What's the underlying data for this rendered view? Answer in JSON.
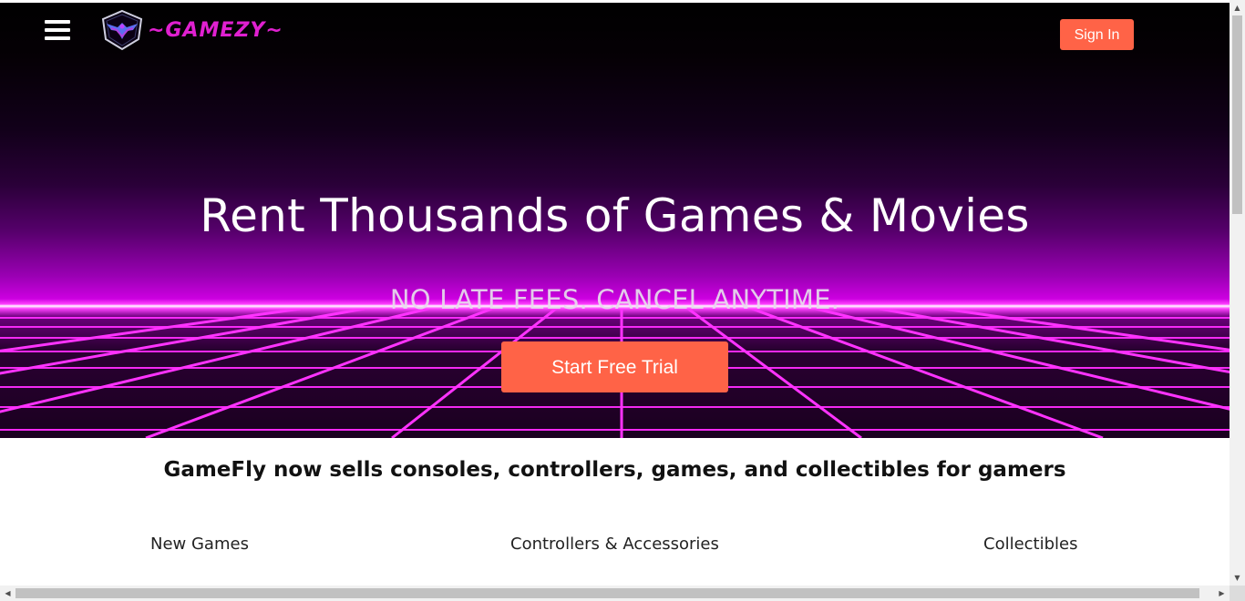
{
  "header": {
    "menu_icon": "hamburger-menu-icon",
    "logo_icon": "winged-shield-logo-icon",
    "logo_text": "~GAMEZY~",
    "signin_label": "Sign In"
  },
  "hero": {
    "title": "Rent Thousands of Games & Movies",
    "subtitle": "NO LATE FEES. CANCEL ANYTIME.",
    "cta_label": "Start Free Trial"
  },
  "main": {
    "tagline": "GameFly now sells consoles, controllers, games, and collectibles for gamers",
    "categories": [
      {
        "label": "New Games"
      },
      {
        "label": "Controllers & Accessories"
      },
      {
        "label": "Collectibles"
      }
    ]
  },
  "colors": {
    "accent": "#ff6347",
    "logo": "#e020d0",
    "neon": "#ff40ff"
  },
  "scrollbars": {
    "up_icon": "scroll-up-arrow-icon",
    "down_icon": "scroll-down-arrow-icon",
    "left_icon": "scroll-left-arrow-icon",
    "right_icon": "scroll-right-arrow-icon"
  }
}
